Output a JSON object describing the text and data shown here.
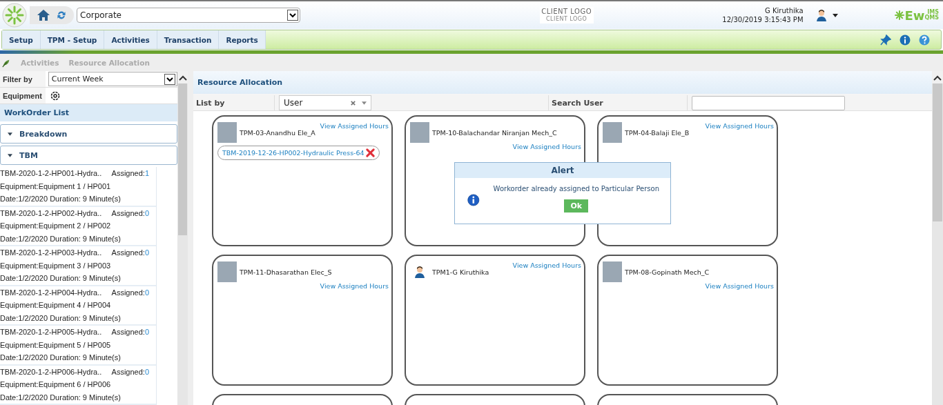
{
  "header": {
    "org_select": "Corporate",
    "client_logo": "CLIENT LOGO",
    "client_logo_sub": "CLIENT LOGO",
    "user_name": "G Kiruthika",
    "datetime": "12/30/2019 3:15:43 PM",
    "brand": {
      "main": "Ew",
      "top": "IMS",
      "bottom": "QMS"
    }
  },
  "nav": [
    "Setup",
    "TPM - Setup",
    "Activities",
    "Transaction",
    "Reports"
  ],
  "breadcrumb": [
    "Activities",
    "Resource Allocation"
  ],
  "sidebar": {
    "filter_label": "Filter by",
    "filter_value": "Current Week",
    "equipment_label": "Equipment",
    "list_title": "WorkOrder List",
    "groups": [
      {
        "label": "Breakdown"
      },
      {
        "label": "TBM",
        "items": [
          {
            "title": "TBM-2020-1-2-HP001-Hydra..",
            "assigned_label": "Assigned:",
            "assigned": "1",
            "equipment": "Equipment:Equipment 1 / HP001",
            "date": "Date:1/2/2020 Duration: 9 Minute(s)"
          },
          {
            "title": "TBM-2020-1-2-HP002-Hydra..",
            "assigned_label": "Assigned:",
            "assigned": "0",
            "equipment": "Equipment:Equipment 2 / HP002",
            "date": "Date:1/2/2020 Duration: 9 Minute(s)"
          },
          {
            "title": "TBM-2020-1-2-HP003-Hydra..",
            "assigned_label": "Assigned:",
            "assigned": "0",
            "equipment": "Equipment:Equipment 3 / HP003",
            "date": "Date:1/2/2020 Duration: 9 Minute(s)"
          },
          {
            "title": "TBM-2020-1-2-HP004-Hydra..",
            "assigned_label": "Assigned:",
            "assigned": "0",
            "equipment": "Equipment:Equipment 4 / HP004",
            "date": "Date:1/2/2020 Duration: 9 Minute(s)"
          },
          {
            "title": "TBM-2020-1-2-HP005-Hydra..",
            "assigned_label": "Assigned:",
            "assigned": "0",
            "equipment": "Equipment:Equipment 5 / HP005",
            "date": "Date:1/2/2020 Duration: 9 Minute(s)"
          },
          {
            "title": "TBM-2020-1-2-HP006-Hydra..",
            "assigned_label": "Assigned:",
            "assigned": "0",
            "equipment": "Equipment:Equipment 6 / HP006",
            "date": "Date:1/2/2020 Duration: 9 Minute(s)"
          }
        ]
      }
    ]
  },
  "main": {
    "title": "Resource Allocation",
    "list_by_label": "List by",
    "list_by_value": "User",
    "search_label": "Search User",
    "cards": [
      {
        "kind": "user",
        "name": "TPM-03-Anandhu Ele_A",
        "photo": true,
        "link": "View Assigned Hours",
        "assignments": [
          "TBM-2019-12-26-HP002-Hydraulic Press-64"
        ]
      },
      {
        "kind": "user",
        "name": "TPM-10-Balachandar Niranjan Mech_C",
        "photo": true,
        "link": "View Assigned Hours"
      },
      {
        "kind": "user",
        "name": "TPM-04-Balaji Ele_B",
        "photo": true,
        "link": "View Assigned Hours"
      },
      {
        "kind": "user",
        "name": "TPM-11-Dhasarathan Elec_S",
        "photo": true,
        "link": "View Assigned Hours"
      },
      {
        "kind": "user",
        "name": "TPM1-G Kiruthika",
        "photo": false,
        "link": "View Assigned Hours"
      },
      {
        "kind": "user",
        "name": "TPM-08-Gopinath Mech_C",
        "photo": true,
        "link": "View Assigned Hours"
      },
      {
        "kind": "partial"
      },
      {
        "kind": "partial"
      },
      {
        "kind": "partial"
      }
    ]
  },
  "alert": {
    "title": "Alert",
    "message": "Workorder already assigned to Particular Person",
    "button": "Ok"
  }
}
